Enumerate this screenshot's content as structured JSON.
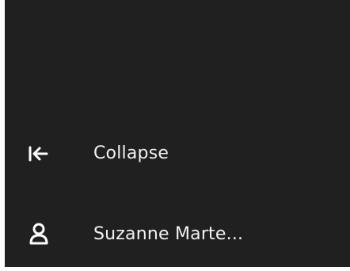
{
  "nav": {
    "collapse": {
      "label": "Collapse",
      "icon": "collapse-left-icon"
    },
    "user": {
      "label": "Suzanne Marte...",
      "icon": "user-icon"
    }
  },
  "colors": {
    "panel_background": "#202020",
    "text": "#f2f2f2",
    "icon": "#ffffff"
  }
}
